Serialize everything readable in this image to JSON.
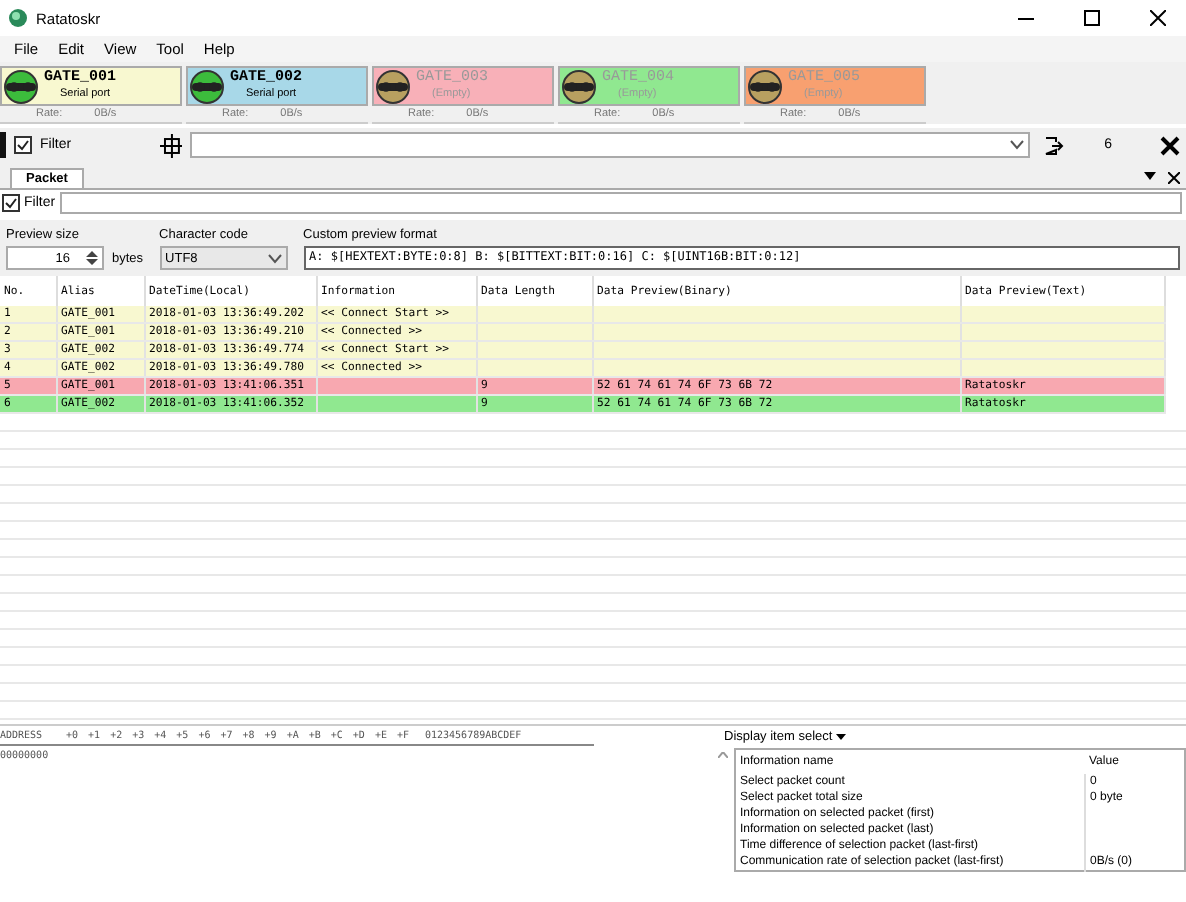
{
  "window": {
    "title": "Ratatoskr"
  },
  "menu": [
    "File",
    "Edit",
    "View",
    "Tool",
    "Help"
  ],
  "gates": [
    {
      "name": "GATE_001",
      "port": "Serial port",
      "connected": true,
      "color": "#f8f8d0",
      "rate_label": "Rate:",
      "rate": "0B/s"
    },
    {
      "name": "GATE_002",
      "port": "Serial port",
      "connected": true,
      "color": "#a8d8e8",
      "rate_label": "Rate:",
      "rate": "0B/s"
    },
    {
      "name": "GATE_003",
      "port": "(Empty)",
      "connected": false,
      "color": "#f8b0b8",
      "rate_label": "Rate:",
      "rate": "0B/s"
    },
    {
      "name": "GATE_004",
      "port": "(Empty)",
      "connected": false,
      "color": "#90e890",
      "rate_label": "Rate:",
      "rate": "0B/s"
    },
    {
      "name": "GATE_005",
      "port": "(Empty)",
      "connected": false,
      "color": "#f8a070",
      "rate_label": "Rate:",
      "rate": "0B/s"
    }
  ],
  "toolbar": {
    "filter_checked": true,
    "filter_label": "Filter",
    "count": "6"
  },
  "tabs": [
    {
      "label": "Packet",
      "selected": true
    }
  ],
  "packet_filter": {
    "checked": true,
    "label": "Filter"
  },
  "preview": {
    "size_label": "Preview size",
    "size": "16",
    "unit": "bytes",
    "charset_label": "Character code",
    "charset": "UTF8",
    "format_label": "Custom preview format",
    "format": "A: $[HEXTEXT:BYTE:0:8] B: $[BITTEXT:BIT:0:16] C: $[UINT16B:BIT:0:12]"
  },
  "table": {
    "columns": [
      "No.",
      "Alias",
      "DateTime(Local)",
      "Information",
      "Data Length",
      "Data Preview(Binary)",
      "Data Preview(Text)"
    ],
    "rows": [
      {
        "color": "#f8f8d0",
        "cells": [
          "1",
          "GATE_001",
          "2018-01-03 13:36:49.202",
          "<< Connect Start >>",
          "",
          "",
          ""
        ]
      },
      {
        "color": "#f8f8d0",
        "cells": [
          "2",
          "GATE_001",
          "2018-01-03 13:36:49.210",
          "<< Connected >>",
          "",
          "",
          ""
        ]
      },
      {
        "color": "#f8f8d0",
        "cells": [
          "3",
          "GATE_002",
          "2018-01-03 13:36:49.774",
          "<< Connect Start >>",
          "",
          "",
          ""
        ]
      },
      {
        "color": "#f8f8d0",
        "cells": [
          "4",
          "GATE_002",
          "2018-01-03 13:36:49.780",
          "<< Connected >>",
          "",
          "",
          ""
        ]
      },
      {
        "color": "#f8a8b0",
        "cells": [
          "5",
          "GATE_001",
          "2018-01-03 13:41:06.351",
          "",
          "9",
          "52 61 74 61 74 6F 73 6B 72",
          "Ratatoskr"
        ]
      },
      {
        "color": "#90e890",
        "cells": [
          "6",
          "GATE_002",
          "2018-01-03 13:41:06.352",
          "",
          "9",
          "52 61 74 61 74 6F 73 6B 72",
          "Ratatoskr"
        ]
      }
    ]
  },
  "hex": {
    "columns": [
      "ADDRESS",
      "+0",
      "+1",
      "+2",
      "+3",
      "+4",
      "+5",
      "+6",
      "+7",
      "+8",
      "+9",
      "+A",
      "+B",
      "+C",
      "+D",
      "+E",
      "+F",
      "0123456789ABCDEF"
    ],
    "rows": [
      "00000000"
    ]
  },
  "info": {
    "button": "Display item select",
    "columns": [
      "Information name",
      "Value"
    ],
    "rows": [
      [
        "Select packet count",
        "0"
      ],
      [
        "Select packet total size",
        "0 byte"
      ],
      [
        "Information on selected packet (first)",
        ""
      ],
      [
        "Information on selected packet (last)",
        ""
      ],
      [
        "Time difference of selection packet (last-first)",
        ""
      ],
      [
        "Communication rate of selection packet (last-first)",
        "0B/s (0)"
      ]
    ]
  }
}
